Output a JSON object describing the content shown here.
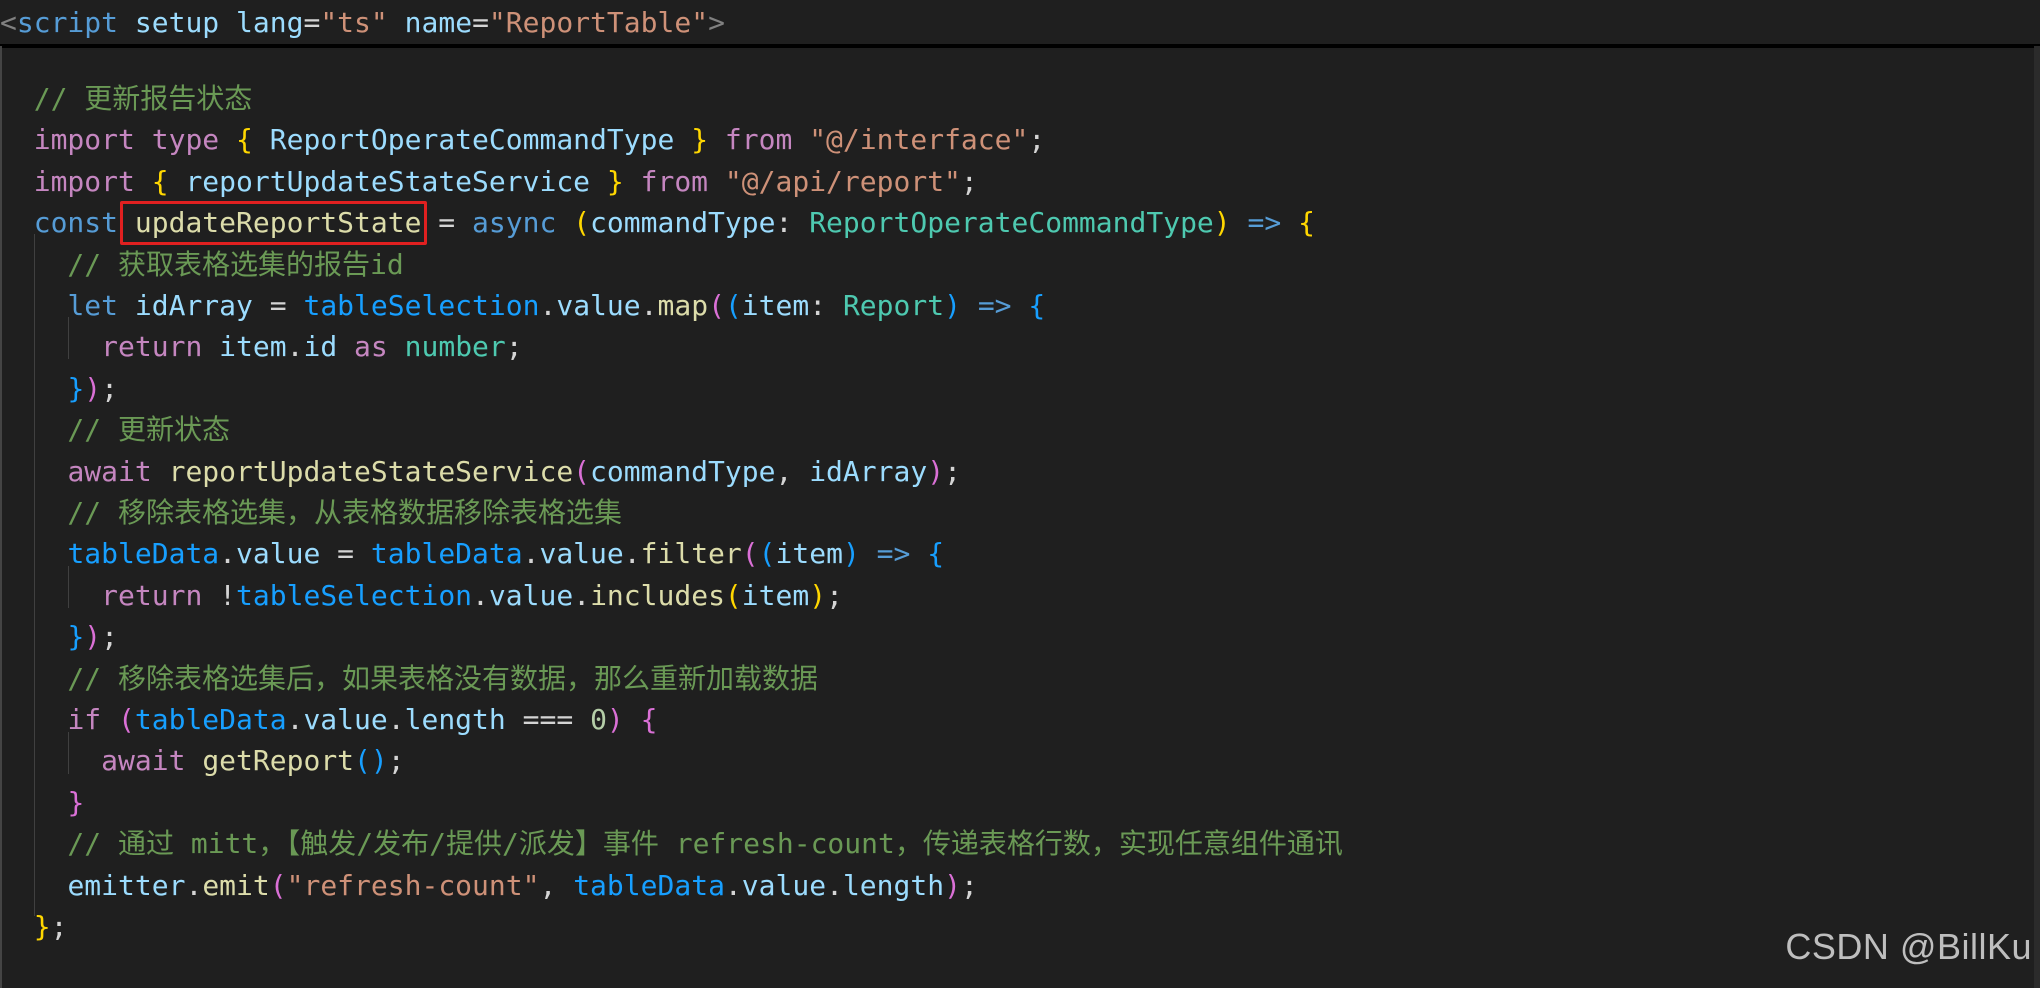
{
  "colors": {
    "background": "#1f1f1f",
    "keyword": "#c586c0",
    "storage": "#569cd6",
    "variable": "#9cdcfe",
    "function": "#dcdcaa",
    "type": "#4ec9b0",
    "string": "#ce9178",
    "comment": "#6a9955",
    "number": "#b5cea8",
    "punct": "#d4d4d4",
    "bracket1": "#ffd700",
    "bracket2": "#da70d6",
    "bracket3": "#179fff",
    "tag": "#569cd6",
    "tagbracket": "#808080",
    "highlight": "#e02020"
  },
  "header": [
    {
      "t": "<",
      "c": "tagbracket"
    },
    {
      "t": "script",
      "c": "tag"
    },
    {
      "t": " ",
      "c": "punct"
    },
    {
      "t": "setup",
      "c": "variable"
    },
    {
      "t": " ",
      "c": "punct"
    },
    {
      "t": "lang",
      "c": "variable"
    },
    {
      "t": "=",
      "c": "punct"
    },
    {
      "t": "\"ts\"",
      "c": "string"
    },
    {
      "t": " ",
      "c": "punct"
    },
    {
      "t": "name",
      "c": "variable"
    },
    {
      "t": "=",
      "c": "punct"
    },
    {
      "t": "\"ReportTable\"",
      "c": "string"
    },
    {
      "t": ">",
      "c": "tagbracket"
    }
  ],
  "code_lines": [
    [
      {
        "t": "  // 更新报告状态",
        "c": "comment"
      }
    ],
    [
      {
        "t": "  ",
        "c": "punct"
      },
      {
        "t": "import",
        "c": "keyword"
      },
      {
        "t": " ",
        "c": "punct"
      },
      {
        "t": "type",
        "c": "keyword"
      },
      {
        "t": " ",
        "c": "punct"
      },
      {
        "t": "{",
        "c": "bracket1"
      },
      {
        "t": " ",
        "c": "punct"
      },
      {
        "t": "ReportOperateCommandType",
        "c": "variable"
      },
      {
        "t": " ",
        "c": "punct"
      },
      {
        "t": "}",
        "c": "bracket1"
      },
      {
        "t": " ",
        "c": "punct"
      },
      {
        "t": "from",
        "c": "keyword"
      },
      {
        "t": " ",
        "c": "punct"
      },
      {
        "t": "\"@/interface\"",
        "c": "string"
      },
      {
        "t": ";",
        "c": "punct"
      }
    ],
    [
      {
        "t": "  ",
        "c": "punct"
      },
      {
        "t": "import",
        "c": "keyword"
      },
      {
        "t": " ",
        "c": "punct"
      },
      {
        "t": "{",
        "c": "bracket1"
      },
      {
        "t": " ",
        "c": "punct"
      },
      {
        "t": "reportUpdateStateService",
        "c": "variable"
      },
      {
        "t": " ",
        "c": "punct"
      },
      {
        "t": "}",
        "c": "bracket1"
      },
      {
        "t": " ",
        "c": "punct"
      },
      {
        "t": "from",
        "c": "keyword"
      },
      {
        "t": " ",
        "c": "punct"
      },
      {
        "t": "\"@/api/report\"",
        "c": "string"
      },
      {
        "t": ";",
        "c": "punct"
      }
    ],
    [
      {
        "t": "  ",
        "c": "punct"
      },
      {
        "t": "const",
        "c": "storage"
      },
      {
        "t": " ",
        "c": "punct"
      },
      {
        "t": "updateReportState",
        "c": "function"
      },
      {
        "t": " = ",
        "c": "punct"
      },
      {
        "t": "async",
        "c": "storage"
      },
      {
        "t": " ",
        "c": "punct"
      },
      {
        "t": "(",
        "c": "bracket1"
      },
      {
        "t": "commandType",
        "c": "variable"
      },
      {
        "t": ": ",
        "c": "punct"
      },
      {
        "t": "ReportOperateCommandType",
        "c": "type"
      },
      {
        "t": ")",
        "c": "bracket1"
      },
      {
        "t": " ",
        "c": "punct"
      },
      {
        "t": "=>",
        "c": "storage"
      },
      {
        "t": " ",
        "c": "punct"
      },
      {
        "t": "{",
        "c": "bracket1"
      }
    ],
    [
      {
        "t": "    // 获取表格选集的报告id",
        "c": "comment"
      }
    ],
    [
      {
        "t": "    ",
        "c": "punct"
      },
      {
        "t": "let",
        "c": "storage"
      },
      {
        "t": " ",
        "c": "punct"
      },
      {
        "t": "idArray",
        "c": "variable"
      },
      {
        "t": " = ",
        "c": "punct"
      },
      {
        "t": "tableSelection",
        "c": "bracket3"
      },
      {
        "t": ".",
        "c": "punct"
      },
      {
        "t": "value",
        "c": "variable"
      },
      {
        "t": ".",
        "c": "punct"
      },
      {
        "t": "map",
        "c": "function"
      },
      {
        "t": "(",
        "c": "bracket2"
      },
      {
        "t": "(",
        "c": "bracket3"
      },
      {
        "t": "item",
        "c": "variable"
      },
      {
        "t": ": ",
        "c": "punct"
      },
      {
        "t": "Report",
        "c": "type"
      },
      {
        "t": ")",
        "c": "bracket3"
      },
      {
        "t": " ",
        "c": "punct"
      },
      {
        "t": "=>",
        "c": "storage"
      },
      {
        "t": " ",
        "c": "punct"
      },
      {
        "t": "{",
        "c": "bracket3"
      }
    ],
    [
      {
        "t": "      ",
        "c": "punct"
      },
      {
        "t": "return",
        "c": "keyword"
      },
      {
        "t": " ",
        "c": "punct"
      },
      {
        "t": "item",
        "c": "variable"
      },
      {
        "t": ".",
        "c": "punct"
      },
      {
        "t": "id",
        "c": "variable"
      },
      {
        "t": " ",
        "c": "punct"
      },
      {
        "t": "as",
        "c": "keyword"
      },
      {
        "t": " ",
        "c": "punct"
      },
      {
        "t": "number",
        "c": "type"
      },
      {
        "t": ";",
        "c": "punct"
      }
    ],
    [
      {
        "t": "    ",
        "c": "punct"
      },
      {
        "t": "}",
        "c": "bracket3"
      },
      {
        "t": ")",
        "c": "bracket2"
      },
      {
        "t": ";",
        "c": "punct"
      }
    ],
    [
      {
        "t": "    // 更新状态",
        "c": "comment"
      }
    ],
    [
      {
        "t": "    ",
        "c": "punct"
      },
      {
        "t": "await",
        "c": "keyword"
      },
      {
        "t": " ",
        "c": "punct"
      },
      {
        "t": "reportUpdateStateService",
        "c": "function"
      },
      {
        "t": "(",
        "c": "bracket2"
      },
      {
        "t": "commandType",
        "c": "variable"
      },
      {
        "t": ", ",
        "c": "punct"
      },
      {
        "t": "idArray",
        "c": "variable"
      },
      {
        "t": ")",
        "c": "bracket2"
      },
      {
        "t": ";",
        "c": "punct"
      }
    ],
    [
      {
        "t": "    // 移除表格选集，从表格数据移除表格选集",
        "c": "comment"
      }
    ],
    [
      {
        "t": "    ",
        "c": "punct"
      },
      {
        "t": "tableData",
        "c": "bracket3"
      },
      {
        "t": ".",
        "c": "punct"
      },
      {
        "t": "value",
        "c": "variable"
      },
      {
        "t": " = ",
        "c": "punct"
      },
      {
        "t": "tableData",
        "c": "bracket3"
      },
      {
        "t": ".",
        "c": "punct"
      },
      {
        "t": "value",
        "c": "variable"
      },
      {
        "t": ".",
        "c": "punct"
      },
      {
        "t": "filter",
        "c": "function"
      },
      {
        "t": "(",
        "c": "bracket2"
      },
      {
        "t": "(",
        "c": "bracket3"
      },
      {
        "t": "item",
        "c": "variable"
      },
      {
        "t": ")",
        "c": "bracket3"
      },
      {
        "t": " ",
        "c": "punct"
      },
      {
        "t": "=>",
        "c": "storage"
      },
      {
        "t": " ",
        "c": "punct"
      },
      {
        "t": "{",
        "c": "bracket3"
      }
    ],
    [
      {
        "t": "      ",
        "c": "punct"
      },
      {
        "t": "return",
        "c": "keyword"
      },
      {
        "t": " !",
        "c": "punct"
      },
      {
        "t": "tableSelection",
        "c": "bracket3"
      },
      {
        "t": ".",
        "c": "punct"
      },
      {
        "t": "value",
        "c": "variable"
      },
      {
        "t": ".",
        "c": "punct"
      },
      {
        "t": "includes",
        "c": "function"
      },
      {
        "t": "(",
        "c": "bracket1"
      },
      {
        "t": "item",
        "c": "variable"
      },
      {
        "t": ")",
        "c": "bracket1"
      },
      {
        "t": ";",
        "c": "punct"
      }
    ],
    [
      {
        "t": "    ",
        "c": "punct"
      },
      {
        "t": "}",
        "c": "bracket3"
      },
      {
        "t": ")",
        "c": "bracket2"
      },
      {
        "t": ";",
        "c": "punct"
      }
    ],
    [
      {
        "t": "    // 移除表格选集后，如果表格没有数据，那么重新加载数据",
        "c": "comment"
      }
    ],
    [
      {
        "t": "    ",
        "c": "punct"
      },
      {
        "t": "if",
        "c": "keyword"
      },
      {
        "t": " ",
        "c": "punct"
      },
      {
        "t": "(",
        "c": "bracket2"
      },
      {
        "t": "tableData",
        "c": "bracket3"
      },
      {
        "t": ".",
        "c": "punct"
      },
      {
        "t": "value",
        "c": "variable"
      },
      {
        "t": ".",
        "c": "punct"
      },
      {
        "t": "length",
        "c": "variable"
      },
      {
        "t": " === ",
        "c": "punct"
      },
      {
        "t": "0",
        "c": "number"
      },
      {
        "t": ")",
        "c": "bracket2"
      },
      {
        "t": " ",
        "c": "punct"
      },
      {
        "t": "{",
        "c": "bracket2"
      }
    ],
    [
      {
        "t": "      ",
        "c": "punct"
      },
      {
        "t": "await",
        "c": "keyword"
      },
      {
        "t": " ",
        "c": "punct"
      },
      {
        "t": "getReport",
        "c": "function"
      },
      {
        "t": "()",
        "c": "bracket3"
      },
      {
        "t": ";",
        "c": "punct"
      }
    ],
    [
      {
        "t": "    ",
        "c": "punct"
      },
      {
        "t": "}",
        "c": "bracket2"
      }
    ],
    [
      {
        "t": "    // 通过 mitt，【触发/发布/提供/派发】事件 refresh-count，传递表格行数，实现任意组件通讯",
        "c": "comment"
      }
    ],
    [
      {
        "t": "    ",
        "c": "punct"
      },
      {
        "t": "emitter",
        "c": "variable"
      },
      {
        "t": ".",
        "c": "punct"
      },
      {
        "t": "emit",
        "c": "function"
      },
      {
        "t": "(",
        "c": "bracket2"
      },
      {
        "t": "\"refresh-count\"",
        "c": "string"
      },
      {
        "t": ", ",
        "c": "punct"
      },
      {
        "t": "tableData",
        "c": "bracket3"
      },
      {
        "t": ".",
        "c": "punct"
      },
      {
        "t": "value",
        "c": "variable"
      },
      {
        "t": ".",
        "c": "punct"
      },
      {
        "t": "length",
        "c": "variable"
      },
      {
        "t": ")",
        "c": "bracket2"
      },
      {
        "t": ";",
        "c": "punct"
      }
    ],
    [
      {
        "t": "  ",
        "c": "punct"
      },
      {
        "t": "}",
        "c": "bracket1"
      },
      {
        "t": ";",
        "c": "punct"
      }
    ]
  ],
  "watermark": "CSDN @BillKu"
}
